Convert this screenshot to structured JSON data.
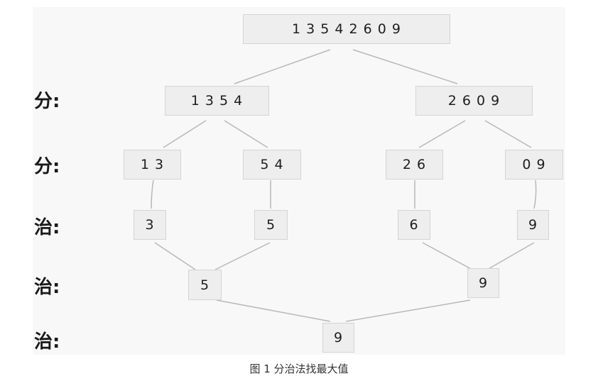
{
  "labels": [
    "分:",
    "分:",
    "治:",
    "治:",
    "治:"
  ],
  "root": "1 3 5 4 2 6 0 9",
  "split1": {
    "left": "1 3 5 4",
    "right": "2 6 0 9"
  },
  "split2": [
    "1 3",
    "5 4",
    "2 6",
    "0 9"
  ],
  "conquer1": [
    "3",
    "5",
    "6",
    "9"
  ],
  "conquer2": [
    "5",
    "9"
  ],
  "result": "9",
  "caption": "图 1 分治法找最大值"
}
